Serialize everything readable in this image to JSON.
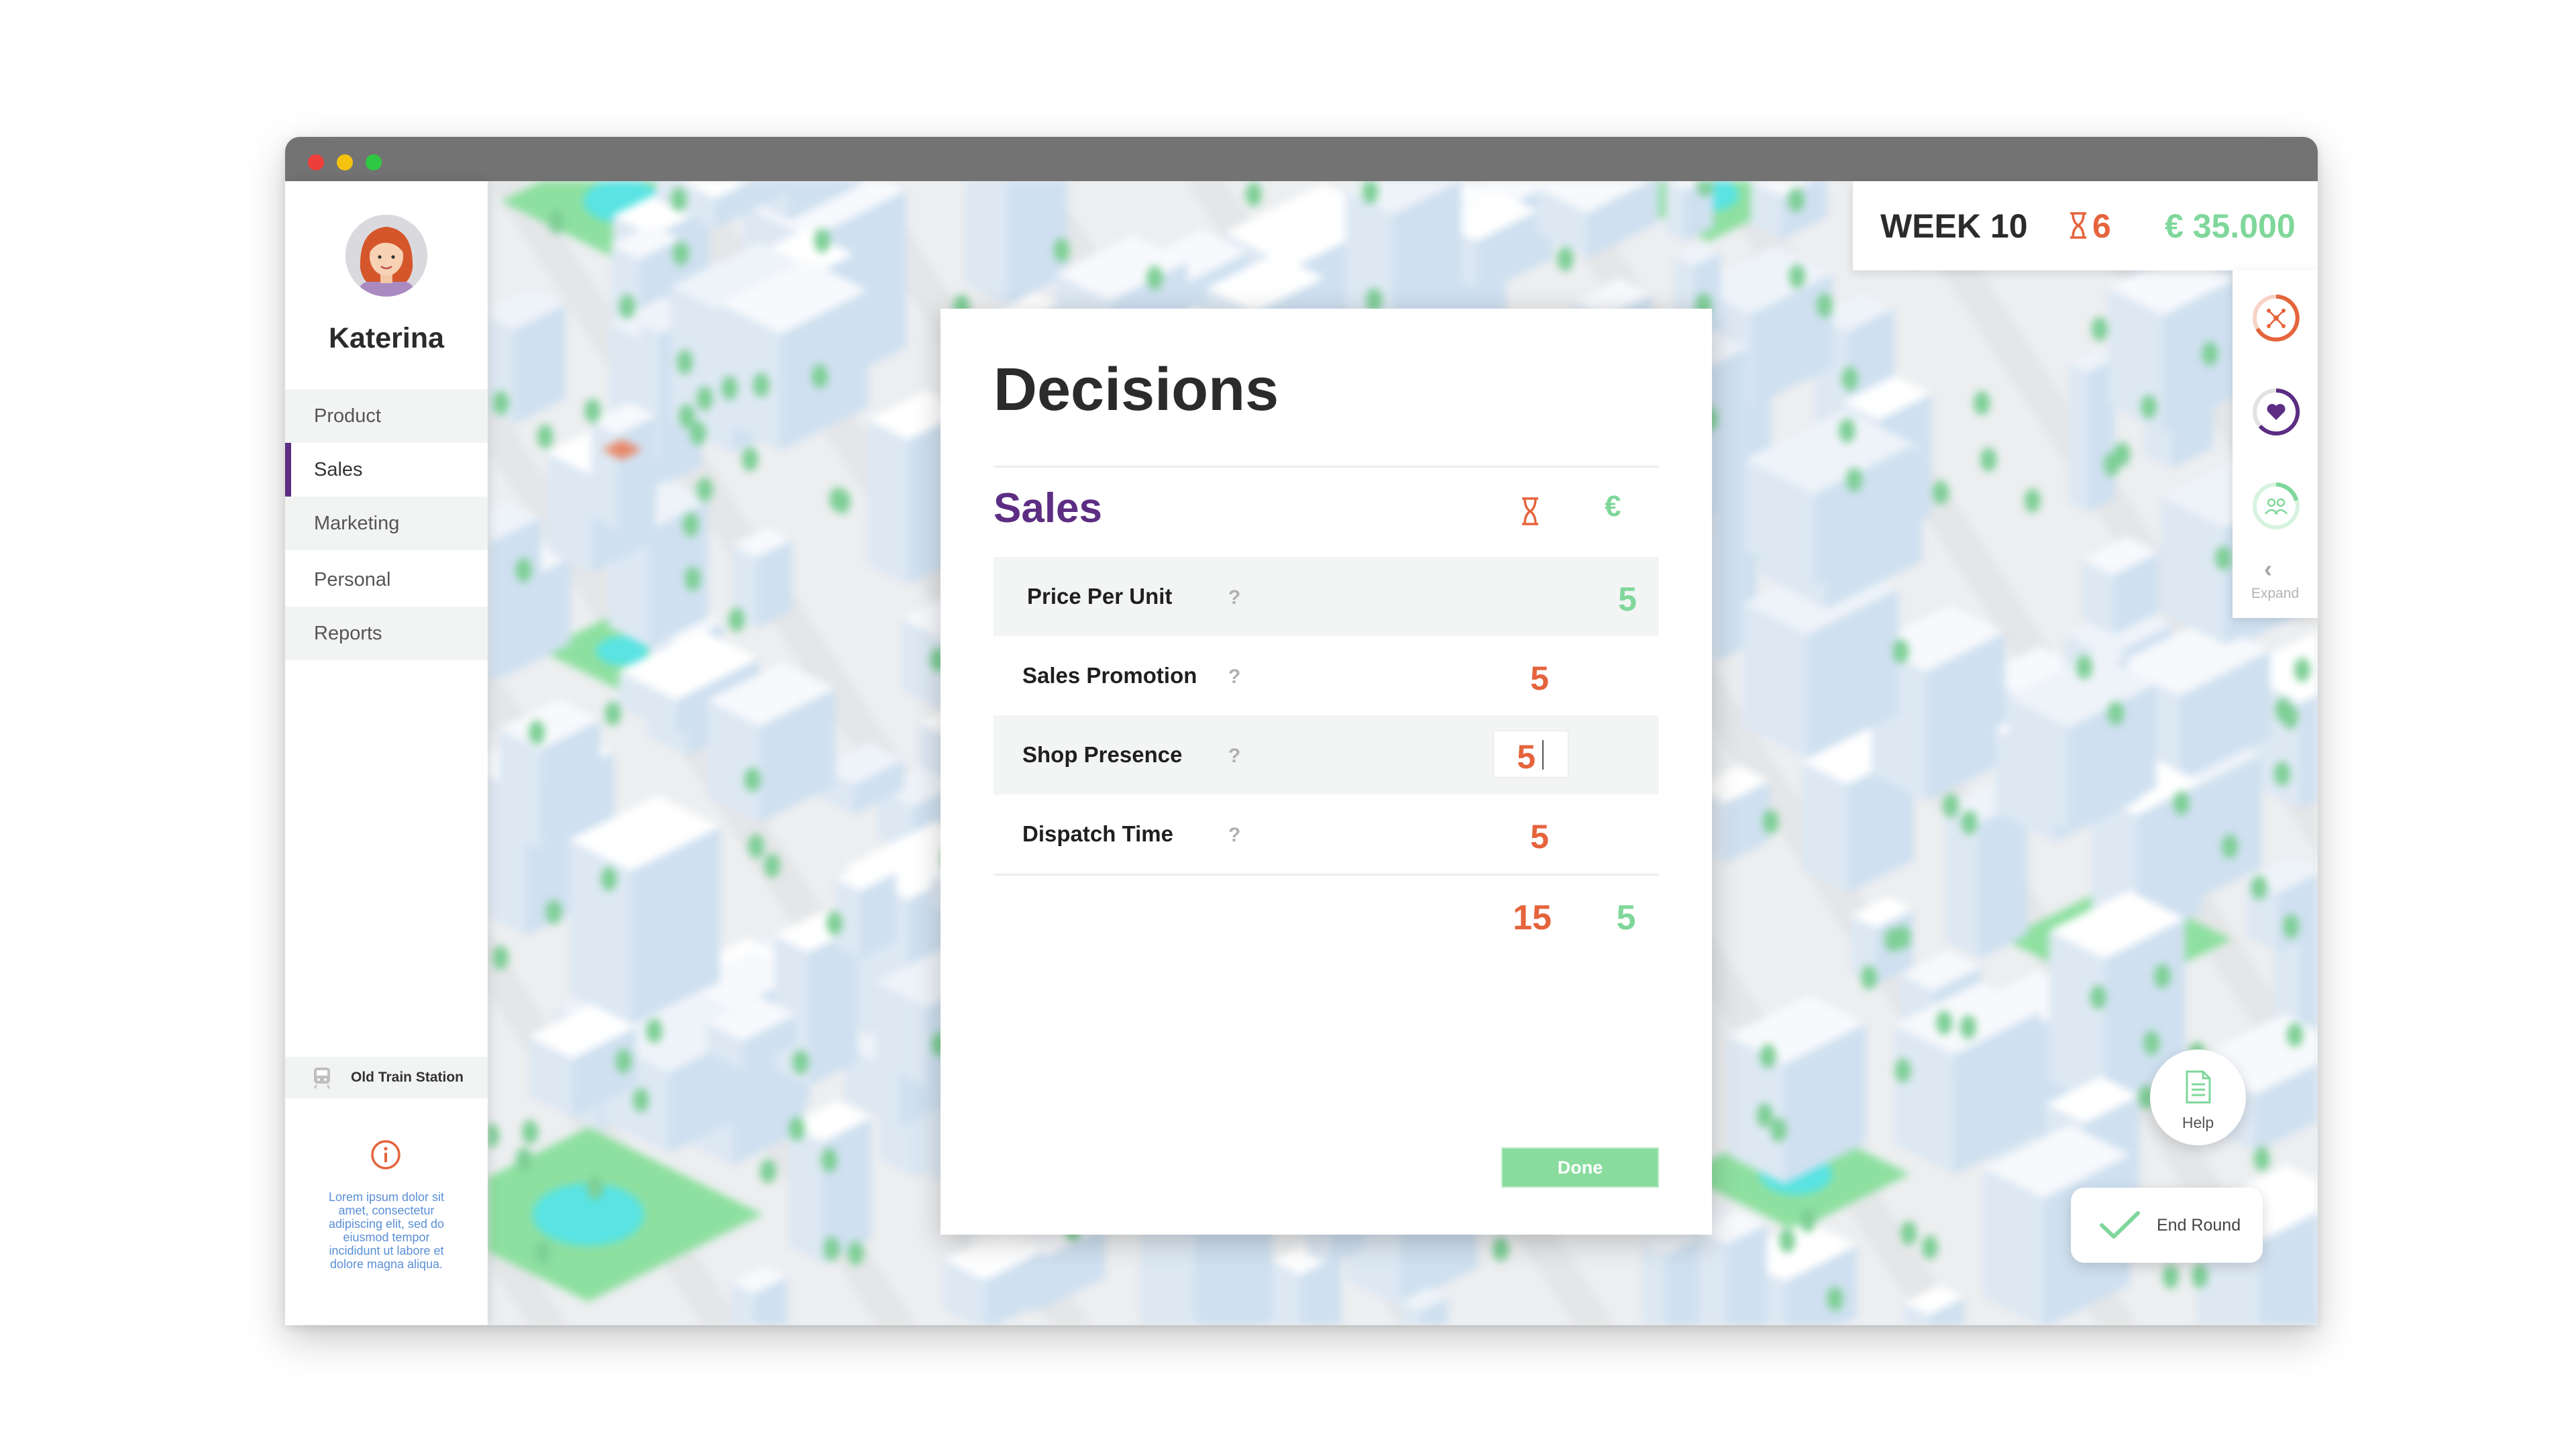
{
  "window": {
    "controls": [
      "close",
      "minimize",
      "maximize"
    ]
  },
  "user": {
    "name": "Katerina",
    "avatar_icon": "user-avatar-icon"
  },
  "sidebar": {
    "items": [
      {
        "label": "Product",
        "active": false
      },
      {
        "label": "Sales",
        "active": true
      },
      {
        "label": "Marketing",
        "active": false
      },
      {
        "label": "Personal",
        "active": false
      },
      {
        "label": "Reports",
        "active": false
      }
    ],
    "location": {
      "icon": "train-icon",
      "label": "Old Train Station"
    },
    "info": {
      "icon": "info-icon",
      "text": "Lorem ipsum dolor sit amet, consectetur adipiscing elit, sed do eiusmod tempor incididunt ut labore et dolore magna aliqua."
    }
  },
  "header": {
    "week": "WEEK 10",
    "hours": "6",
    "money": "€ 35.000",
    "hour_icon": "hourglass-icon"
  },
  "rail": {
    "indicators": [
      {
        "icon": "network-icon",
        "color": "#e5643c"
      },
      {
        "icon": "heart-icon",
        "color": "#5c2d82"
      },
      {
        "icon": "people-icon",
        "color": "#7fd79a"
      }
    ],
    "expand_label": "Expand"
  },
  "modal": {
    "title": "Decisions",
    "section": "Sales",
    "columns": {
      "hours_icon": "hourglass-icon",
      "euro": "€"
    },
    "rows": [
      {
        "label": "Price Per Unit",
        "help": "?",
        "hours": "",
        "euro": "5"
      },
      {
        "label": "Sales Promotion",
        "help": "?",
        "hours": "5",
        "euro": ""
      },
      {
        "label": "Shop Presence",
        "help": "?",
        "hours": "5",
        "euro": ""
      },
      {
        "label": "Dispatch Time",
        "help": "?",
        "hours": "5",
        "euro": ""
      }
    ],
    "totals": {
      "hours": "15",
      "euro": "5"
    },
    "done_label": "Done"
  },
  "help": {
    "label": "Help",
    "icon": "document-icon"
  },
  "end_round": {
    "label": "End Round",
    "icon": "check-icon"
  },
  "colors": {
    "accent_purple": "#5c2d82",
    "hours_orange": "#e5643c",
    "money_green": "#7fd79a"
  }
}
